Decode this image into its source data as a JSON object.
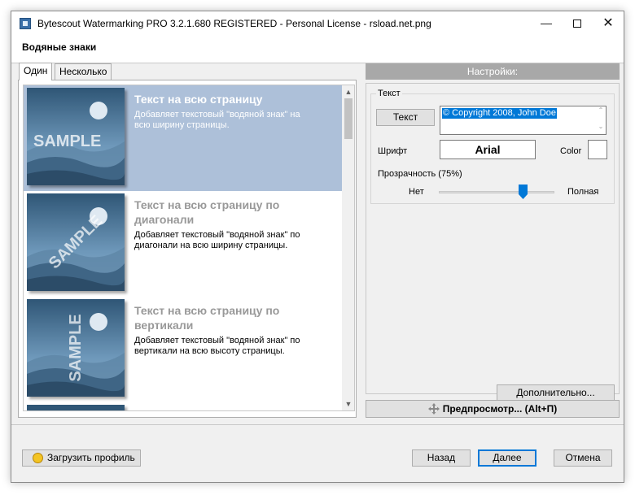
{
  "window": {
    "title": "Bytescout Watermarking PRO 3.2.1.680 REGISTERED - Personal License - rsload.net.png",
    "header": "Водяные знаки"
  },
  "tabs": [
    {
      "label": "Один",
      "active": true
    },
    {
      "label": "Несколько",
      "active": false
    }
  ],
  "watermark_types": [
    {
      "title": "Текст на всю страницу",
      "description": "Добавляет текстовый \"водяной знак\" на всю ширину страницы.",
      "thumbnail_text": "SAMPLE",
      "selected": true
    },
    {
      "title": "Текст на всю страницу по диагонали",
      "description": "Добавляет текстовый \"водяной знак\" по диагонали на всю ширину страницы.",
      "thumbnail_text": "SAMPLE",
      "selected": false
    },
    {
      "title": "Текст на всю страницу по вертикали",
      "description": "Добавляет текстовый \"водяной знак\" по вертикали на всю высоту страницы.",
      "thumbnail_text": "SAMPLE",
      "selected": false
    }
  ],
  "settings": {
    "header": "Настройки:",
    "group_label": "Текст",
    "text_button": "Текст",
    "text_value": "© Copyright 2008, John Doe",
    "font_label": "Шрифт",
    "font_value": "Arial",
    "color_label": "Color",
    "color_value": "#ffffff",
    "opacity_label": "Прозрачность (75%)",
    "opacity_percent": 75,
    "slider_min_label": "Нет",
    "slider_max_label": "Полная",
    "more_button": "Дополнительно..."
  },
  "preview_button": "Предпросмотр... (Alt+П)",
  "footer": {
    "load_profile": "Загрузить профиль",
    "back": "Назад",
    "next": "Далее",
    "cancel": "Отмена"
  },
  "colors": {
    "selection": "#adc0d9",
    "thumb_dark": "#2e4f6e",
    "thumb_light": "#7fa8c8",
    "accent": "#0078d7"
  }
}
